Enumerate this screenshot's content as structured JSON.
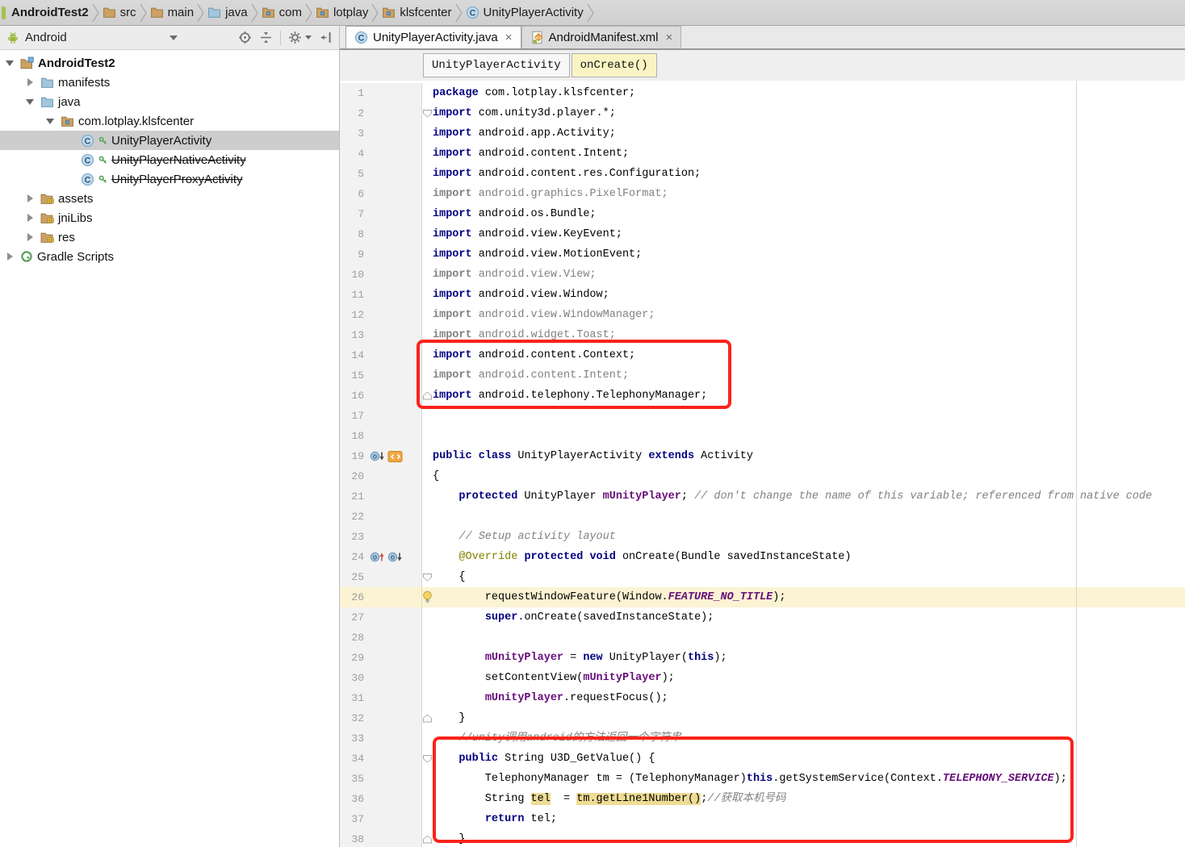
{
  "colors": {
    "annotation_red": "#fb231b",
    "keyword_blue": "#000080",
    "field_purple": "#660e7a",
    "unused_gray": "#818181",
    "annotation_olive": "#808000",
    "current_line_bg": "#fbf3d3",
    "usage_highlight_bg": "#eedc96",
    "tree_selection_bg": "#cdcdcd"
  },
  "breadcrumb": {
    "items": [
      {
        "label": "AndroidTest2",
        "icon": "none",
        "bold": true
      },
      {
        "label": "src",
        "icon": "folder"
      },
      {
        "label": "main",
        "icon": "folder"
      },
      {
        "label": "java",
        "icon": "folder-blue"
      },
      {
        "label": "com",
        "icon": "package"
      },
      {
        "label": "lotplay",
        "icon": "package"
      },
      {
        "label": "klsfcenter",
        "icon": "package"
      },
      {
        "label": "UnityPlayerActivity",
        "icon": "class"
      }
    ]
  },
  "toolbar": {
    "view_selector": "Android"
  },
  "project_tree": {
    "items": [
      {
        "label": "AndroidTest2",
        "indent": 0,
        "arrow": "open",
        "icon": "folder-project",
        "bold": true
      },
      {
        "label": "manifests",
        "indent": 1,
        "arrow": "closed",
        "icon": "folder-blue"
      },
      {
        "label": "java",
        "indent": 1,
        "arrow": "open",
        "icon": "folder-blue"
      },
      {
        "label": "com.lotplay.klsfcenter",
        "indent": 2,
        "arrow": "open",
        "icon": "package"
      },
      {
        "label": "UnityPlayerActivity",
        "indent": 3,
        "arrow": "none",
        "icon": "class-key",
        "selected": true
      },
      {
        "label": "UnityPlayerNativeActivity",
        "indent": 3,
        "arrow": "none",
        "icon": "class-key",
        "strikethrough": true
      },
      {
        "label": "UnityPlayerProxyActivity",
        "indent": 3,
        "arrow": "none",
        "icon": "class-key",
        "strikethrough": true
      },
      {
        "label": "assets",
        "indent": 1,
        "arrow": "closed",
        "icon": "folder-res"
      },
      {
        "label": "jniLibs",
        "indent": 1,
        "arrow": "closed",
        "icon": "folder-res"
      },
      {
        "label": "res",
        "indent": 1,
        "arrow": "closed",
        "icon": "folder-res"
      },
      {
        "label": "Gradle Scripts",
        "indent": 0,
        "arrow": "closed",
        "icon": "gradle"
      }
    ]
  },
  "editor": {
    "tabs": [
      {
        "label": "UnityPlayerActivity.java",
        "icon": "class",
        "active": true,
        "close": "×"
      },
      {
        "label": "AndroidManifest.xml",
        "icon": "manifest",
        "active": false,
        "close": "×"
      }
    ],
    "nav_chips": [
      {
        "label": "UnityPlayerActivity"
      },
      {
        "label": "onCreate()"
      }
    ],
    "code": {
      "lines": [
        {
          "n": 1,
          "seg": [
            [
              "k",
              "package"
            ],
            [
              "p",
              " com.lotplay.klsfcenter;"
            ]
          ]
        },
        {
          "n": 2,
          "seg": [
            [
              "k",
              "import"
            ],
            [
              "p",
              " com.unity3d.player.*;"
            ]
          ],
          "fold": "open"
        },
        {
          "n": 3,
          "seg": [
            [
              "k",
              "import"
            ],
            [
              "p",
              " android.app.Activity;"
            ]
          ]
        },
        {
          "n": 4,
          "seg": [
            [
              "k",
              "import"
            ],
            [
              "p",
              " android.content.Intent;"
            ]
          ]
        },
        {
          "n": 5,
          "seg": [
            [
              "k",
              "import"
            ],
            [
              "p",
              " android.content.res.Configuration;"
            ]
          ]
        },
        {
          "n": 6,
          "seg": [
            [
              "gb",
              "import"
            ],
            [
              "g",
              " android.graphics.PixelFormat;"
            ]
          ]
        },
        {
          "n": 7,
          "seg": [
            [
              "k",
              "import"
            ],
            [
              "p",
              " android.os.Bundle;"
            ]
          ]
        },
        {
          "n": 8,
          "seg": [
            [
              "k",
              "import"
            ],
            [
              "p",
              " android.view.KeyEvent;"
            ]
          ]
        },
        {
          "n": 9,
          "seg": [
            [
              "k",
              "import"
            ],
            [
              "p",
              " android.view.MotionEvent;"
            ]
          ]
        },
        {
          "n": 10,
          "seg": [
            [
              "gb",
              "import"
            ],
            [
              "g",
              " android.view.View;"
            ]
          ]
        },
        {
          "n": 11,
          "seg": [
            [
              "k",
              "import"
            ],
            [
              "p",
              " android.view.Window;"
            ]
          ]
        },
        {
          "n": 12,
          "seg": [
            [
              "gb",
              "import"
            ],
            [
              "g",
              " android.view.WindowManager;"
            ]
          ]
        },
        {
          "n": 13,
          "seg": [
            [
              "gb",
              "import"
            ],
            [
              "g",
              " android.widget.Toast;"
            ]
          ]
        },
        {
          "n": 14,
          "seg": [
            [
              "k",
              "import"
            ],
            [
              "p",
              " android.content.Context;"
            ]
          ]
        },
        {
          "n": 15,
          "seg": [
            [
              "gb",
              "import"
            ],
            [
              "g",
              " android.content.Intent;"
            ]
          ]
        },
        {
          "n": 16,
          "seg": [
            [
              "k",
              "import"
            ],
            [
              "p",
              " android.telephony.TelephonyManager;"
            ]
          ],
          "fold": "close"
        },
        {
          "n": 17,
          "seg": []
        },
        {
          "n": 18,
          "seg": []
        },
        {
          "n": 19,
          "seg": [
            [
              "k",
              "public class"
            ],
            [
              "p",
              " UnityPlayerActivity "
            ],
            [
              "k",
              "extends"
            ],
            [
              "p",
              " Activity"
            ]
          ],
          "icons": [
            "implementations-down",
            "android-component"
          ]
        },
        {
          "n": 20,
          "seg": [
            [
              "p",
              "{"
            ]
          ]
        },
        {
          "n": 21,
          "seg": [
            [
              "p",
              "    "
            ],
            [
              "k",
              "protected"
            ],
            [
              "p",
              " UnityPlayer "
            ],
            [
              "f",
              "mUnityPlayer"
            ],
            [
              "p",
              "; "
            ],
            [
              "c",
              "// don't change the name of this variable; referenced from native code"
            ]
          ]
        },
        {
          "n": 22,
          "seg": []
        },
        {
          "n": 23,
          "seg": [
            [
              "p",
              "    "
            ],
            [
              "c",
              "// Setup activity layout"
            ]
          ]
        },
        {
          "n": 24,
          "seg": [
            [
              "p",
              "    "
            ],
            [
              "a",
              "@Override"
            ],
            [
              "p",
              " "
            ],
            [
              "k",
              "protected void"
            ],
            [
              "p",
              " onCreate(Bundle savedInstanceState)"
            ]
          ],
          "icons": [
            "overrides-up",
            "implementations-down"
          ]
        },
        {
          "n": 25,
          "seg": [
            [
              "p",
              "    {"
            ]
          ],
          "fold": "open"
        },
        {
          "n": 26,
          "seg": [
            [
              "p",
              "        requestWindowFeature(Window."
            ],
            [
              "s",
              "FEATURE_NO_TITLE"
            ],
            [
              "p",
              ");"
            ]
          ],
          "cur": true,
          "bulb": true
        },
        {
          "n": 27,
          "seg": [
            [
              "p",
              "        "
            ],
            [
              "k",
              "super"
            ],
            [
              "p",
              ".onCreate(savedInstanceState);"
            ]
          ]
        },
        {
          "n": 28,
          "seg": []
        },
        {
          "n": 29,
          "seg": [
            [
              "p",
              "        "
            ],
            [
              "f",
              "mUnityPlayer"
            ],
            [
              "p",
              " = "
            ],
            [
              "k",
              "new"
            ],
            [
              "p",
              " UnityPlayer("
            ],
            [
              "k",
              "this"
            ],
            [
              "p",
              ");"
            ]
          ]
        },
        {
          "n": 30,
          "seg": [
            [
              "p",
              "        setContentView("
            ],
            [
              "f",
              "mUnityPlayer"
            ],
            [
              "p",
              ");"
            ]
          ]
        },
        {
          "n": 31,
          "seg": [
            [
              "p",
              "        "
            ],
            [
              "f",
              "mUnityPlayer"
            ],
            [
              "p",
              ".requestFocus();"
            ]
          ]
        },
        {
          "n": 32,
          "seg": [
            [
              "p",
              "    }"
            ]
          ],
          "fold": "close"
        },
        {
          "n": 33,
          "seg": [
            [
              "p",
              "    "
            ],
            [
              "c",
              "//unity调用android的方法返回一个字符串"
            ]
          ]
        },
        {
          "n": 34,
          "seg": [
            [
              "p",
              "    "
            ],
            [
              "k",
              "public"
            ],
            [
              "p",
              " String U3D_GetValue() {"
            ]
          ],
          "fold": "open"
        },
        {
          "n": 35,
          "seg": [
            [
              "p",
              "        TelephonyManager tm = (TelephonyManager)"
            ],
            [
              "k",
              "this"
            ],
            [
              "p",
              ".getSystemService(Context."
            ],
            [
              "s",
              "TELEPHONY_SERVICE"
            ],
            [
              "p",
              ");"
            ]
          ]
        },
        {
          "n": 36,
          "seg": [
            [
              "p",
              "        String "
            ],
            [
              "h",
              "tel"
            ],
            [
              "p",
              "  = "
            ],
            [
              "h",
              "tm.getLine1Number()"
            ],
            [
              "p",
              ";"
            ],
            [
              "c",
              "//获取本机号码"
            ]
          ]
        },
        {
          "n": 37,
          "seg": [
            [
              "p",
              "        "
            ],
            [
              "k",
              "return"
            ],
            [
              "p",
              " tel;"
            ]
          ]
        },
        {
          "n": 38,
          "seg": [
            [
              "p",
              "    }"
            ]
          ],
          "fold": "close"
        }
      ]
    }
  },
  "annotations": {
    "boxes": [
      {
        "label": "red-box-imports",
        "around_lines": "14-16"
      },
      {
        "label": "red-box-u3d-getvalue-method",
        "around_lines": "34-38"
      }
    ]
  }
}
